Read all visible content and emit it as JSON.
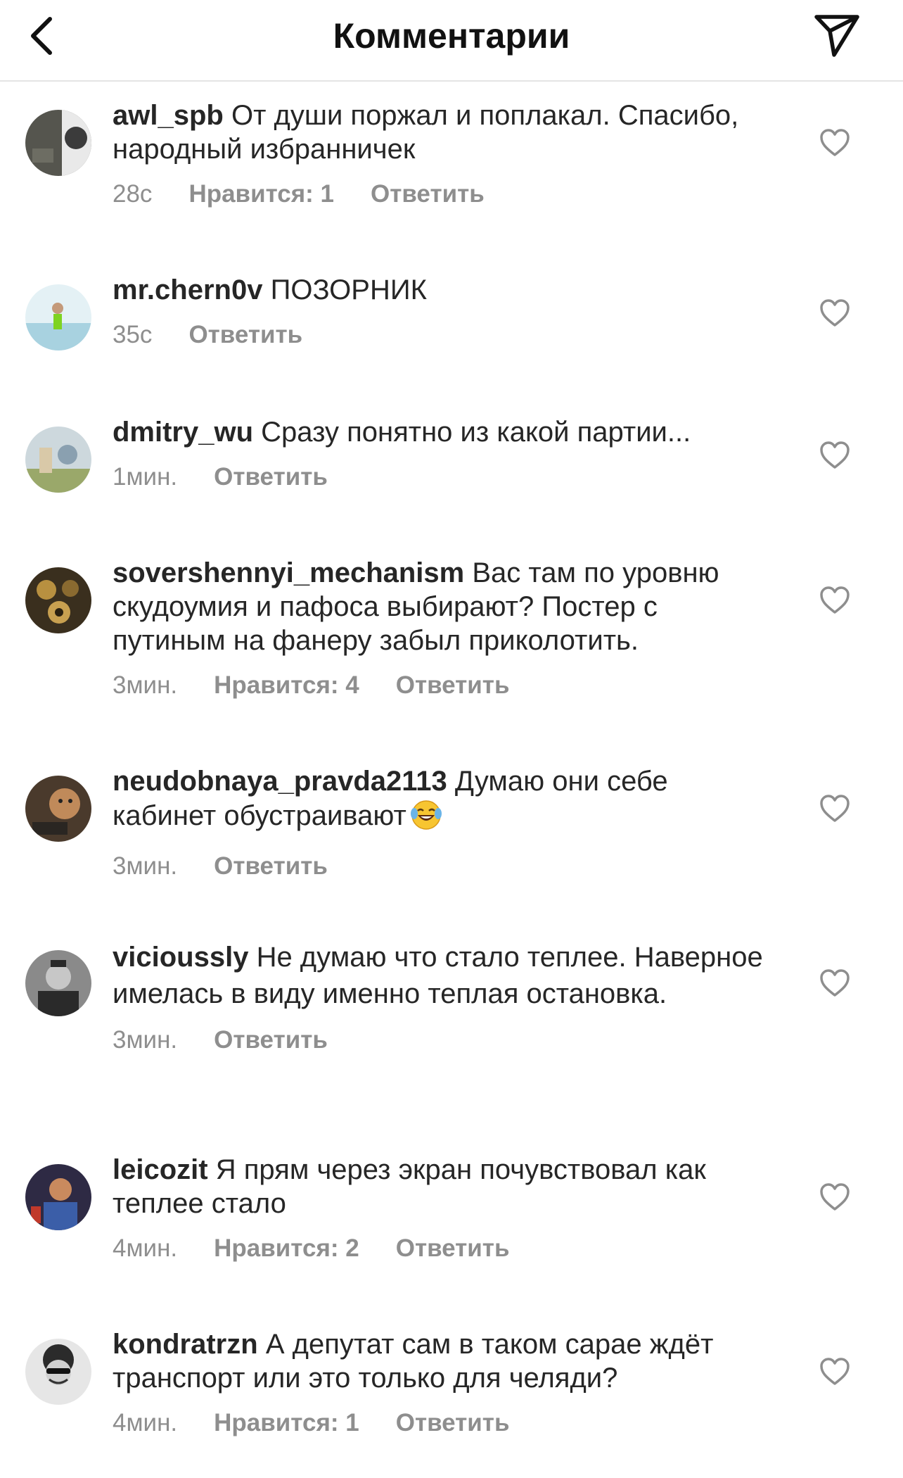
{
  "header": {
    "title": "Комментарии",
    "back_icon": "chevron-left-icon",
    "share_icon": "paper-plane-icon"
  },
  "comments": [
    {
      "username": "awl_spb",
      "text": "От души поржал и поплакал. Спасибо, народный избранничек",
      "time": "28с",
      "likes": "Нравится: 1",
      "reply": "Ответить",
      "avatar_colors": [
        "#5a5a52",
        "#e8e8e8"
      ]
    },
    {
      "username": "mr.chern0v",
      "text": "ПОЗОРНИК",
      "time": "35с",
      "likes": "",
      "reply": "Ответить",
      "avatar_colors": [
        "#dfeef3",
        "#8fc3d6"
      ]
    },
    {
      "username": "dmitry_wu",
      "text": "Сразу понятно из какой партии...",
      "time": "1мин.",
      "likes": "",
      "reply": "Ответить",
      "avatar_colors": [
        "#c9d6dc",
        "#9aa86a"
      ]
    },
    {
      "username": "sovershennyi_mechanism",
      "text": "Вас там по уровню скудоумия и пафоса выбирают? Постер с путиным на фанеру забыл приколотить.",
      "time": "3мин.",
      "likes": "Нравится: 4",
      "reply": "Ответить",
      "avatar_colors": [
        "#3a2f1e",
        "#b89040"
      ]
    },
    {
      "username": "neudobnaya_pravda2113",
      "text": "Думаю они себе кабинет обустраивают",
      "emoji": "😂",
      "time": "3мин.",
      "likes": "",
      "reply": "Ответить",
      "avatar_colors": [
        "#4a3a2c",
        "#c08a5a"
      ]
    },
    {
      "username": "viciousslу",
      "text": "Не думаю что стало теплее. Наверное имелась в виду именно теплая остановка.",
      "time": "3мин.",
      "likes": "",
      "reply": "Ответить",
      "avatar_colors": [
        "#6b6b6b",
        "#2a2a2a"
      ]
    },
    {
      "username": "leicozit",
      "text": "Я прям через экран почувствовал как теплее стало",
      "time": "4мин.",
      "likes": "Нравится: 2",
      "reply": "Ответить",
      "avatar_colors": [
        "#2e2a44",
        "#c98a5e"
      ]
    },
    {
      "username": "kondratrzn",
      "text": "А депутат сам в таком сарае ждёт транспорт или это только для челяди?",
      "time": "4мин.",
      "likes": "Нравится: 1",
      "reply": "Ответить",
      "avatar_colors": [
        "#e6e6e6",
        "#2b2b2b"
      ]
    }
  ]
}
